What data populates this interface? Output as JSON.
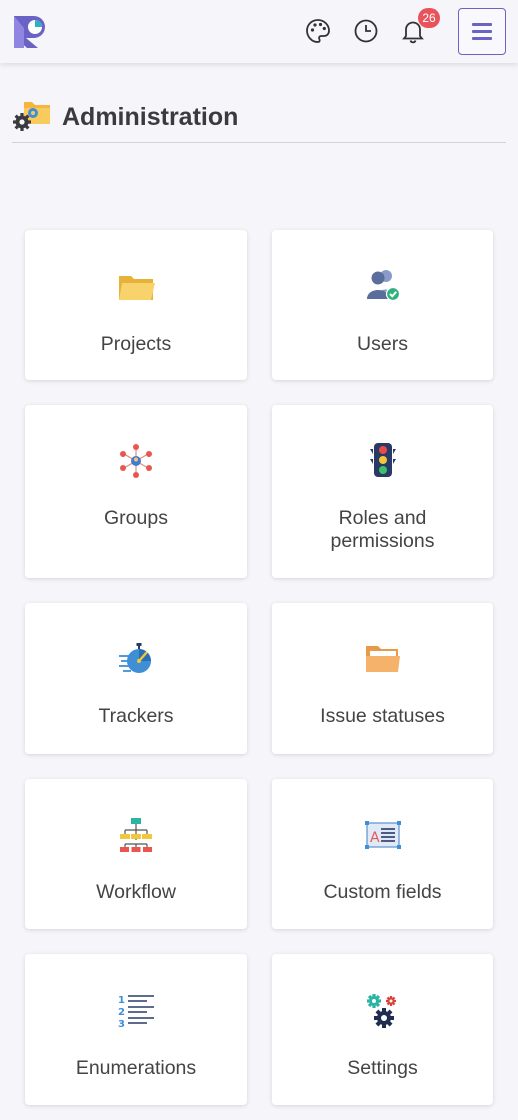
{
  "topbar": {
    "logo_icon": "app-logo-icon",
    "theme_icon": "palette-icon",
    "history_icon": "clock-icon",
    "notifications_icon": "bell-icon",
    "notifications_count": "26",
    "menu_icon": "hamburger-menu-icon",
    "accent_color": "#6a62c4",
    "badge_color": "#e9545c"
  },
  "page": {
    "title": "Administration",
    "title_icon": "folder-gear-icon"
  },
  "cards": [
    {
      "label": "Projects",
      "icon": "folder-icon"
    },
    {
      "label": "Users",
      "icon": "users-icon"
    },
    {
      "label": "Groups",
      "icon": "group-network-icon"
    },
    {
      "label": "Roles and\npermissions",
      "icon": "traffic-light-icon"
    },
    {
      "label": "Trackers",
      "icon": "tracker-icon"
    },
    {
      "label": "Issue statuses",
      "icon": "open-folder-icon"
    },
    {
      "label": "Workflow",
      "icon": "workflow-icon"
    },
    {
      "label": "Custom fields",
      "icon": "text-field-icon"
    },
    {
      "label": "Enumerations",
      "icon": "numbered-list-icon"
    },
    {
      "label": "Settings",
      "icon": "gears-icon"
    }
  ]
}
